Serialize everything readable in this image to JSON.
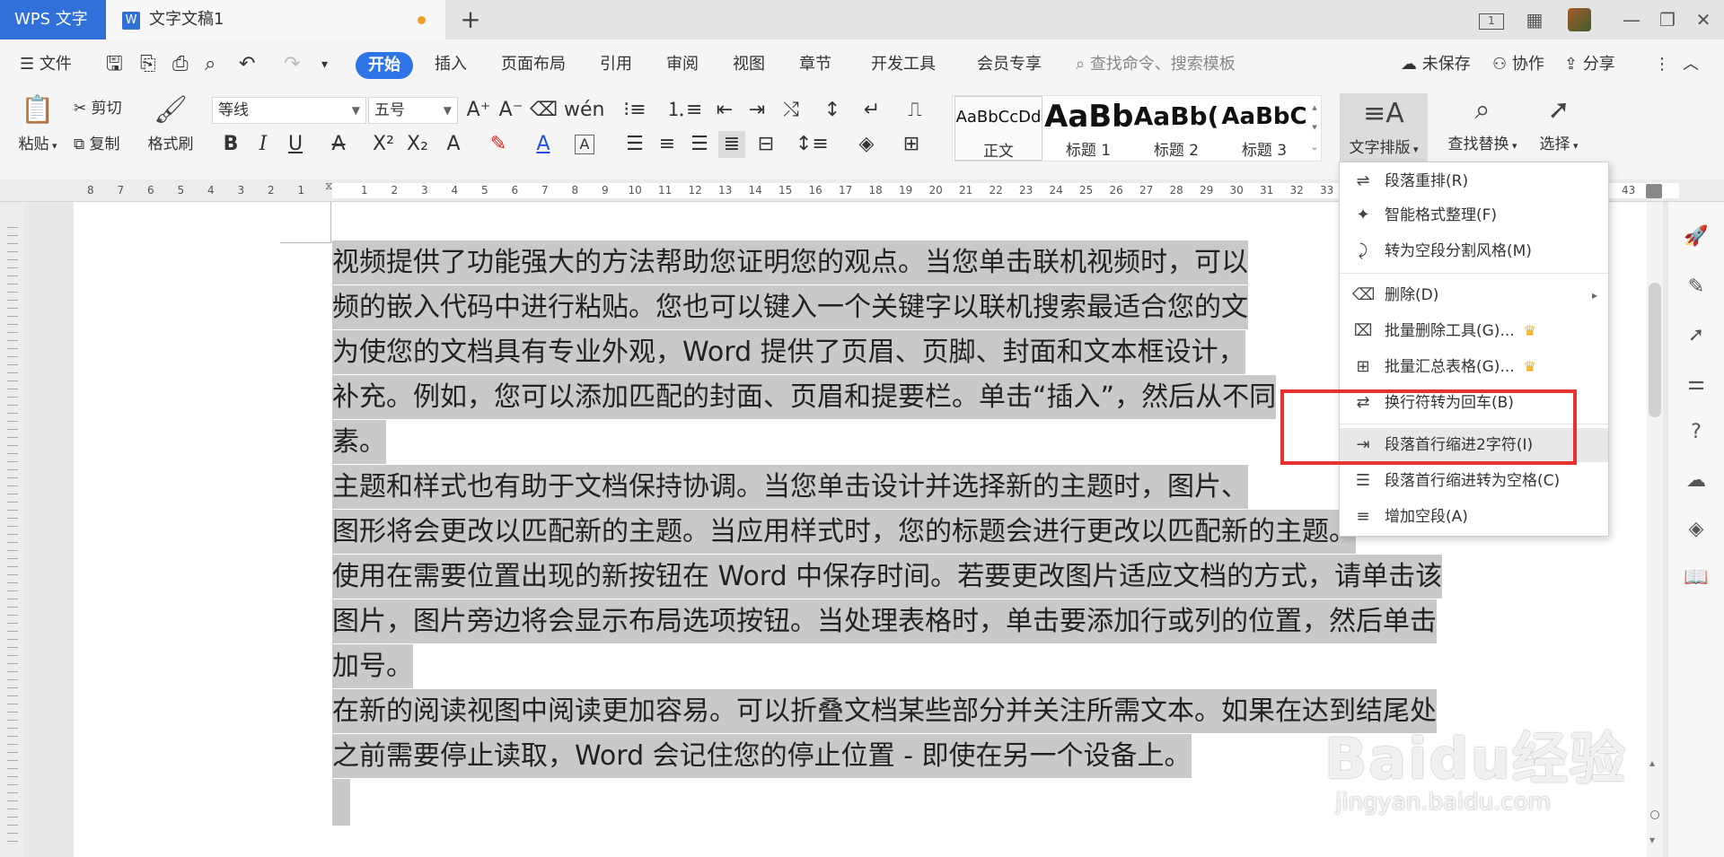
{
  "titlebar": {
    "app_tab": "WPS 文字",
    "doc_tab": "文字文稿1",
    "doc_icon": "W",
    "new_tab_icon": "+",
    "page_badge": "1"
  },
  "menubar": {
    "file": "文件",
    "tabs": [
      "开始",
      "插入",
      "页面布局",
      "引用",
      "审阅",
      "视图",
      "章节",
      "开发工具",
      "会员专享"
    ],
    "search_placeholder": "查找命令、搜索模板",
    "unsaved": "未保存",
    "collab": "协作",
    "share": "分享"
  },
  "ribbon": {
    "paste": "粘贴",
    "cut": "剪切",
    "copy": "复制",
    "format_painter": "格式刷",
    "font_name": "等线",
    "font_size": "五号",
    "styles": [
      {
        "preview": "AaBbCcDd",
        "label": "正文"
      },
      {
        "preview": "AaBb",
        "label": "标题 1"
      },
      {
        "preview": "AaBb(",
        "label": "标题 2"
      },
      {
        "preview": "AaBbC",
        "label": "标题 3"
      }
    ],
    "text_layout": "文字排版",
    "find_replace": "查找替换",
    "select": "选择"
  },
  "ruler": {
    "ticks_left": [
      "8",
      "7",
      "6",
      "5",
      "4",
      "3",
      "2",
      "1"
    ],
    "ticks_right": [
      "1",
      "2",
      "3",
      "4",
      "5",
      "6",
      "7",
      "8",
      "9",
      "10",
      "11",
      "12",
      "13",
      "14",
      "15",
      "16",
      "17",
      "18",
      "19",
      "20",
      "21",
      "22",
      "23",
      "24",
      "25",
      "26",
      "27",
      "28",
      "29",
      "30",
      "31",
      "32",
      "33"
    ],
    "tick_end": "43"
  },
  "document": {
    "lines": [
      "视频提供了功能强大的方法帮助您证明您的观点。当您单击联机视频时，可以",
      "频的嵌入代码中进行粘贴。您也可以键入一个关键字以联机搜索最适合您的文",
      "为使您的文档具有专业外观，Word 提供了页眉、页脚、封面和文本框设计，",
      "补充。例如，您可以添加匹配的封面、页眉和提要栏。单击“插入”，然后从不同",
      "素。",
      "主题和样式也有助于文档保持协调。当您单击设计并选择新的主题时，图片、",
      "图形将会更改以匹配新的主题。当应用样式时，您的标题会进行更改以匹配新的主题。",
      "使用在需要位置出现的新按钮在 Word 中保存时间。若要更改图片适应文档的方式，请单击该",
      "图片，图片旁边将会显示布局选项按钮。当处理表格时，单击要添加行或列的位置，然后单击",
      "加号。",
      "在新的阅读视图中阅读更加容易。可以折叠文档某些部分并关注所需文本。如果在达到结尾处",
      "之前需要停止读取，Word 会记住您的停止位置 - 即使在另一个设备上。"
    ]
  },
  "dropdown": {
    "items": [
      {
        "label": "段落重排(R)",
        "icon": "reflow-icon"
      },
      {
        "label": "智能格式整理(F)",
        "icon": "smart-format-icon"
      },
      {
        "label": "转为空段分割风格(M)",
        "icon": "empty-para-icon"
      },
      {
        "label": "删除(D)",
        "icon": "delete-icon",
        "submenu": true
      },
      {
        "label": "批量删除工具(G)...",
        "icon": "batch-delete-icon",
        "vip": true
      },
      {
        "label": "批量汇总表格(G)...",
        "icon": "batch-table-icon",
        "vip": true
      },
      {
        "label": "换行符转为回车(B)",
        "icon": "linebreak-icon"
      },
      {
        "label": "段落首行缩进2字符(I)",
        "icon": "indent-icon",
        "highlighted": true
      },
      {
        "label": "段落首行缩进转为空格(C)",
        "icon": "indent-space-icon"
      },
      {
        "label": "增加空段(A)",
        "icon": "add-para-icon"
      }
    ]
  },
  "watermark": {
    "brand": "Baidu经验",
    "url": "jingyan.baidu.com"
  },
  "colors": {
    "accent": "#2f74e6",
    "app_tab": "#3070d8",
    "highlight_box": "#e83232",
    "selection": "#c9c9c9"
  }
}
